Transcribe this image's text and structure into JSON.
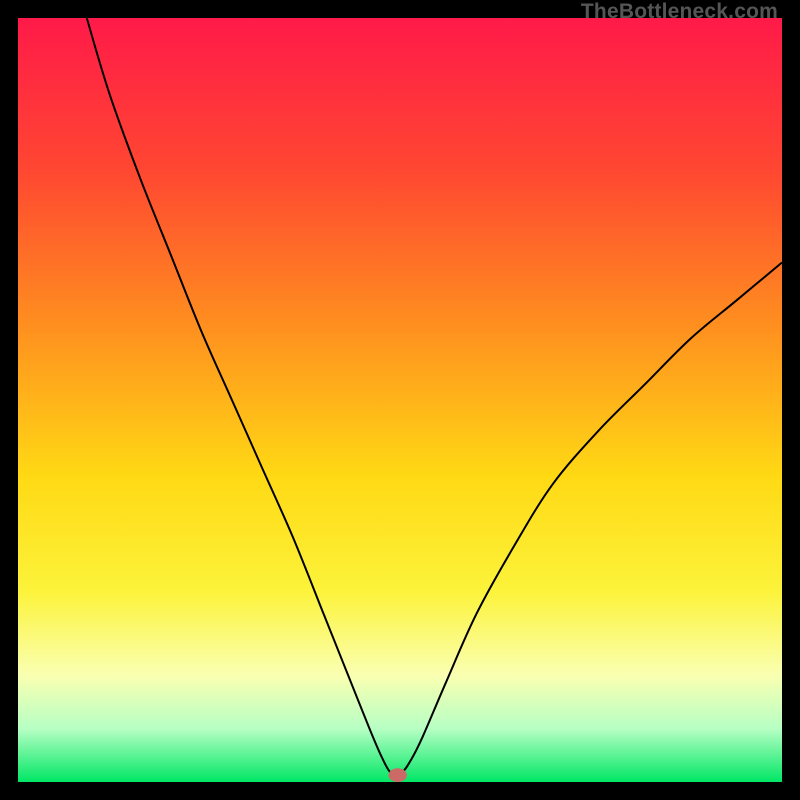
{
  "watermark_text": "TheBottleneck.com",
  "chart_data": {
    "type": "line",
    "title": "",
    "xlabel": "",
    "ylabel": "",
    "xlim": [
      0,
      100
    ],
    "ylim": [
      0,
      100
    ],
    "gradient_stops": [
      {
        "offset": 0,
        "color": "#ff1a49"
      },
      {
        "offset": 20,
        "color": "#ff4731"
      },
      {
        "offset": 40,
        "color": "#ff8e1f"
      },
      {
        "offset": 60,
        "color": "#ffd914"
      },
      {
        "offset": 75,
        "color": "#fcf33a"
      },
      {
        "offset": 86,
        "color": "#faffb1"
      },
      {
        "offset": 93,
        "color": "#b7ffc4"
      },
      {
        "offset": 100,
        "color": "#00e765"
      }
    ],
    "series": [
      {
        "name": "bottleneck-curve",
        "stroke": "#000000",
        "x": [
          9,
          12,
          16,
          20,
          24,
          28,
          32,
          36,
          40,
          42,
          44,
          46,
          47.5,
          48.8,
          50.2,
          51.5,
          53,
          56,
          60,
          65,
          70,
          76,
          82,
          88,
          94,
          100
        ],
        "values": [
          100,
          90,
          79,
          69,
          59,
          50,
          41,
          32,
          22,
          17,
          12,
          7,
          3.5,
          1.2,
          1.2,
          3.0,
          6,
          13,
          22,
          31,
          39,
          46,
          52,
          58,
          63,
          68
        ]
      }
    ],
    "marker": {
      "name": "optimal-point",
      "x": 49.7,
      "y": 0.9,
      "rx": 1.2,
      "ry": 0.9,
      "fill": "#cc6a66"
    }
  }
}
